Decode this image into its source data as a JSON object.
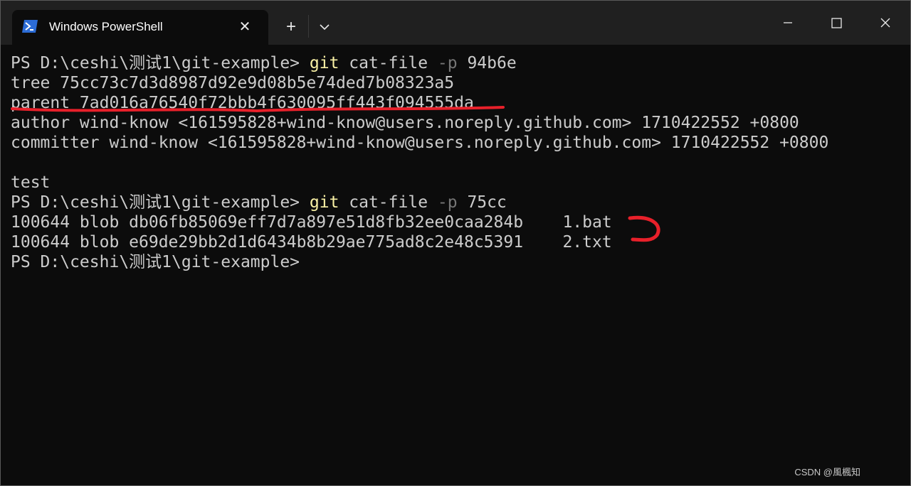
{
  "window": {
    "tab_title": "Windows PowerShell",
    "tab_close_glyph": "✕",
    "new_tab_glyph": "+"
  },
  "colors": {
    "background": "#0c0c0c",
    "titlebar": "#202020",
    "text": "#cccccc",
    "command": "#f9f1a5",
    "parameter": "#767676",
    "annotation": "#e8202a"
  },
  "icons": {
    "tab": "powershell-icon",
    "close_tab": "close-icon",
    "new_tab": "plus-icon",
    "dropdown": "chevron-down-icon",
    "minimize": "minimize-icon",
    "maximize": "maximize-icon",
    "close_window": "close-icon"
  },
  "terminal": {
    "line1": {
      "prompt": "PS D:\\ceshi\\测试1\\git-example> ",
      "cmd": "git",
      "rest1": " cat-file ",
      "flag": "-p",
      "rest2": " 94b6e"
    },
    "line2": "tree 75cc73c7d3d8987d92e9d08b5e74ded7b08323a5",
    "line3": "parent 7ad016a76540f72bbb4f630095ff443f094555da",
    "line4": "author wind-know <161595828+wind-know@users.noreply.github.com> 1710422552 +0800",
    "line5": "committer wind-know <161595828+wind-know@users.noreply.github.com> 1710422552 +0800",
    "line6": "",
    "line7": "test",
    "line8": {
      "prompt": "PS D:\\ceshi\\测试1\\git-example> ",
      "cmd": "git",
      "rest1": " cat-file ",
      "flag": "-p",
      "rest2": " 75cc"
    },
    "line9": "100644 blob db06fb85069eff7d7a897e51d8fb32ee0caa284b    1.bat",
    "line10": "100644 blob e69de29bb2d1d6434b8b29ae775ad8c2e48c5391    2.txt",
    "line11": "PS D:\\ceshi\\测试1\\git-example> "
  },
  "watermark": "CSDN @風楓知"
}
